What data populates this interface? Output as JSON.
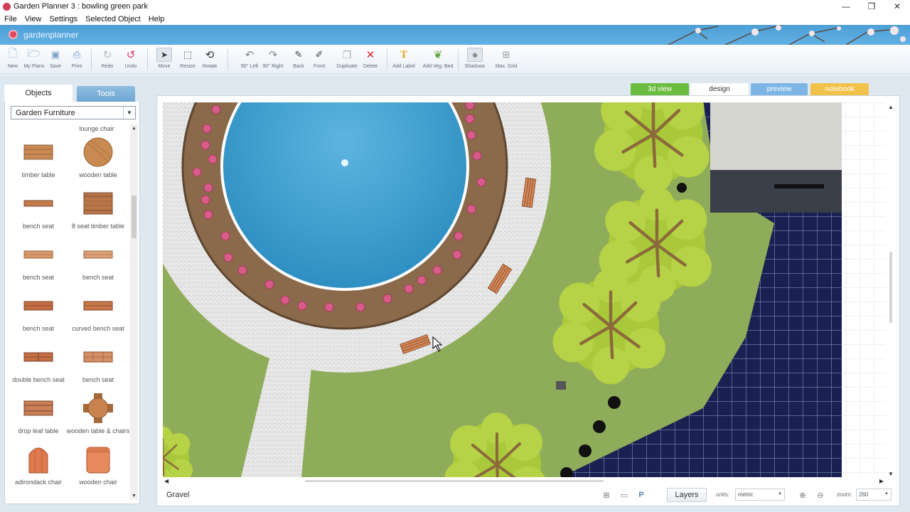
{
  "window": {
    "title": "Garden Planner 3 : bowling green park",
    "controls": [
      "—",
      "❐",
      "✕"
    ]
  },
  "menu": [
    "File",
    "View",
    "Settings",
    "Selected Object",
    "Help"
  ],
  "brand": {
    "name": "gardenplanner"
  },
  "toolbar": {
    "new": "New",
    "my_plans": "My Plans",
    "save": "Save",
    "print": "Print",
    "redo": "Redo",
    "undo": "Undo",
    "move": "Move",
    "resize": "Resize",
    "rotate": "Rotate",
    "rot_left": "90° Left",
    "rot_right": "90° Right",
    "back": "Back",
    "front": "Front",
    "duplicate": "Duplicate",
    "delete": "Delete",
    "add_label": "Add Label",
    "add_veg_bed": "Add Veg. Bed",
    "shadows": "Shadows",
    "max_grid": "Max. Grid"
  },
  "left_panel": {
    "tabs": [
      "Objects",
      "Tools"
    ],
    "category": "Garden Furniture",
    "partial_item": "lounge chair",
    "items": [
      {
        "label": "timber table",
        "color": "#c98a55"
      },
      {
        "label": "wooden table",
        "color": "#c88a50"
      },
      {
        "label": "bench seat",
        "color": "#c47a4a"
      },
      {
        "label": "8 seat timber table",
        "color": "#b9764a"
      },
      {
        "label": "bench seat",
        "color": "#d79a6c"
      },
      {
        "label": "bench seat",
        "color": "#dca27a"
      },
      {
        "label": "bench seat",
        "color": "#c46e45"
      },
      {
        "label": "curved bench seat",
        "color": "#c8784b"
      },
      {
        "label": "double bench seat",
        "color": "#c46e45"
      },
      {
        "label": "bench seat",
        "color": "#d69066"
      },
      {
        "label": "drop leaf table",
        "color": "#c98058"
      },
      {
        "label": "wooden table & chairs",
        "color": "#c8834f"
      },
      {
        "label": "adirondack chair",
        "color": "#e07a4e"
      },
      {
        "label": "wooden chair",
        "color": "#e68a5c"
      }
    ]
  },
  "view_tabs": [
    "3d view",
    "design",
    "preview",
    "notebook"
  ],
  "status": {
    "material": "Gravel",
    "layers": "Layers",
    "units_label": "units:",
    "units_value": "metric",
    "zoom_label": "zoom:",
    "zoom_value": "260"
  },
  "colors": {
    "lawn": "#8fac5a",
    "gravel": "#e6e6e6",
    "pond": "#3e9ccc",
    "bed_soil": "#8a6a4a",
    "tree": "#a9c83a",
    "court": "#1a2052"
  }
}
